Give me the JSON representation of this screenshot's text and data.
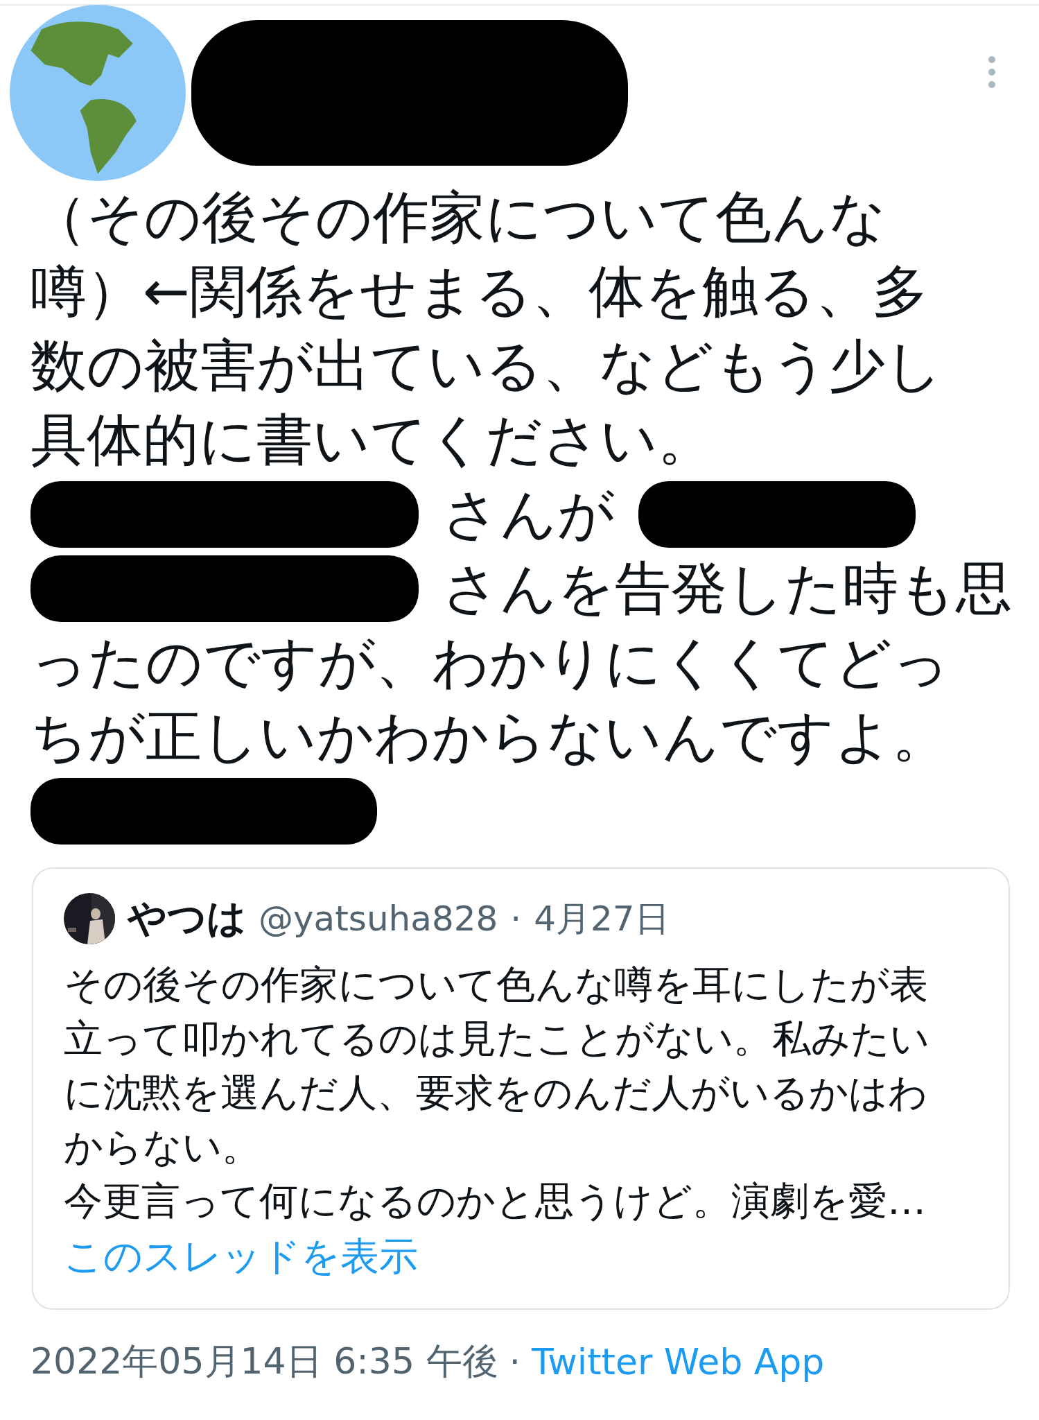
{
  "tweet": {
    "author": {
      "name_redacted": true
    },
    "body_lines": [
      [
        {
          "kind": "text",
          "text": "（その後その作家について色んな"
        }
      ],
      [
        {
          "kind": "text",
          "text": "噂）←関係をせまる、体を触る、多"
        }
      ],
      [
        {
          "kind": "text",
          "text": "数の被害が出ている、などもう少し"
        }
      ],
      [
        {
          "kind": "text",
          "text": "具体的に書いてください。"
        }
      ],
      [
        {
          "kind": "redaction"
        },
        {
          "kind": "text",
          "text": "さんが"
        },
        {
          "kind": "redaction"
        }
      ],
      [
        {
          "kind": "redaction"
        },
        {
          "kind": "text",
          "text": "さんを告発した時も思"
        }
      ],
      [
        {
          "kind": "text",
          "text": "ったのですが、わかりにくくてどっ"
        }
      ],
      [
        {
          "kind": "text",
          "text": "ちが正しいかわからないんですよ。"
        }
      ],
      [
        {
          "kind": "redaction"
        }
      ]
    ],
    "quote": {
      "name": "やつは",
      "handle": "@yatsuha828",
      "separator": "·",
      "date": "4月27日",
      "paragraphs": [
        "その後その作家について色んな噂を耳にしたが表立って叩かれてるのは見たことがない。私みたいに沈黙を選んだ人、要求をのんだ人がいるかはわからない。",
        "今更言って何になるのかと思うけど。演劇を愛…"
      ],
      "link": "このスレッドを表示"
    },
    "timestamp": "2022年05月14日 6:35 午後",
    "separator": "·",
    "source": "Twitter Web App"
  }
}
